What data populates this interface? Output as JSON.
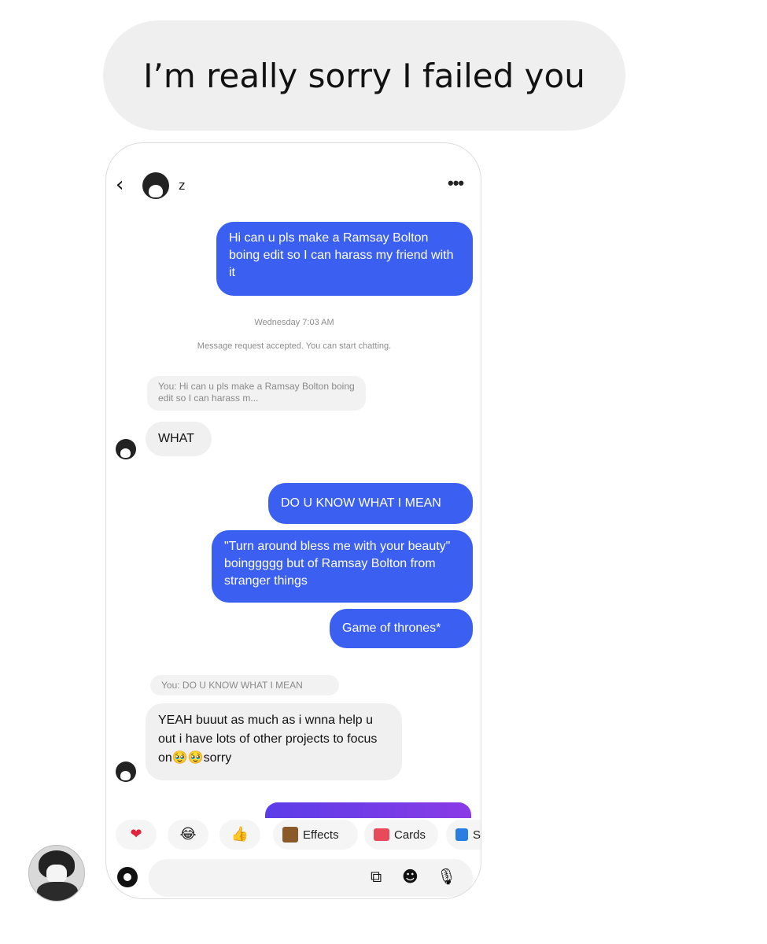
{
  "post": {
    "caption": "I’m really sorry I failed you"
  },
  "chat": {
    "contact_name": "z",
    "header_back": "‹",
    "header_more": "•••",
    "messages": [
      {
        "type": "sent",
        "text": "Hi can u pls make a Ramsay Bolton boing edit so I can harass my friend with it"
      },
      {
        "type": "sent",
        "text": "DO U KNOW WHAT I MEAN"
      },
      {
        "type": "sent",
        "text": "\"Turn around bless me with your beauty\" boinggggg but of Ramsay Bolton from stranger things"
      },
      {
        "type": "sent",
        "text": "Game of thrones*"
      },
      {
        "type": "received",
        "text": "WHAT",
        "reply_to": "You: Hi can u pls make a Ramsay Bolton boing edit so I can harass m..."
      },
      {
        "type": "received",
        "text": "YEAH buuut as much as i wnna help u out i have lots of other projects to focus on🥹🥹sorry",
        "reply_to": "You: DO U KNOW WHAT I MEAN"
      }
    ],
    "timestamp": "Wednesday 7:03 AM",
    "system_note": "Message request accepted. You can start chatting."
  },
  "toolbar": {
    "items": [
      {
        "label": "",
        "icon": "heart-icon",
        "glyph": "❤"
      },
      {
        "label": "",
        "icon": "laughing-emoji-icon",
        "glyph": "😂"
      },
      {
        "label": "",
        "icon": "thumbs-up-icon",
        "glyph": "👍"
      },
      {
        "label": "Effects",
        "icon": "effects-icon"
      },
      {
        "label": "Cards",
        "icon": "cards-icon"
      },
      {
        "label": "S",
        "icon": "more-chip-icon"
      }
    ]
  },
  "composer": {
    "placeholder": "",
    "icons": [
      "camera-icon",
      "gallery-icon",
      "sticker-icon",
      "mic-icon"
    ]
  },
  "colors": {
    "sent_bubble": "#3b5ff0",
    "received_bubble": "#f0f0f0",
    "caption_bubble": "#efefef"
  }
}
